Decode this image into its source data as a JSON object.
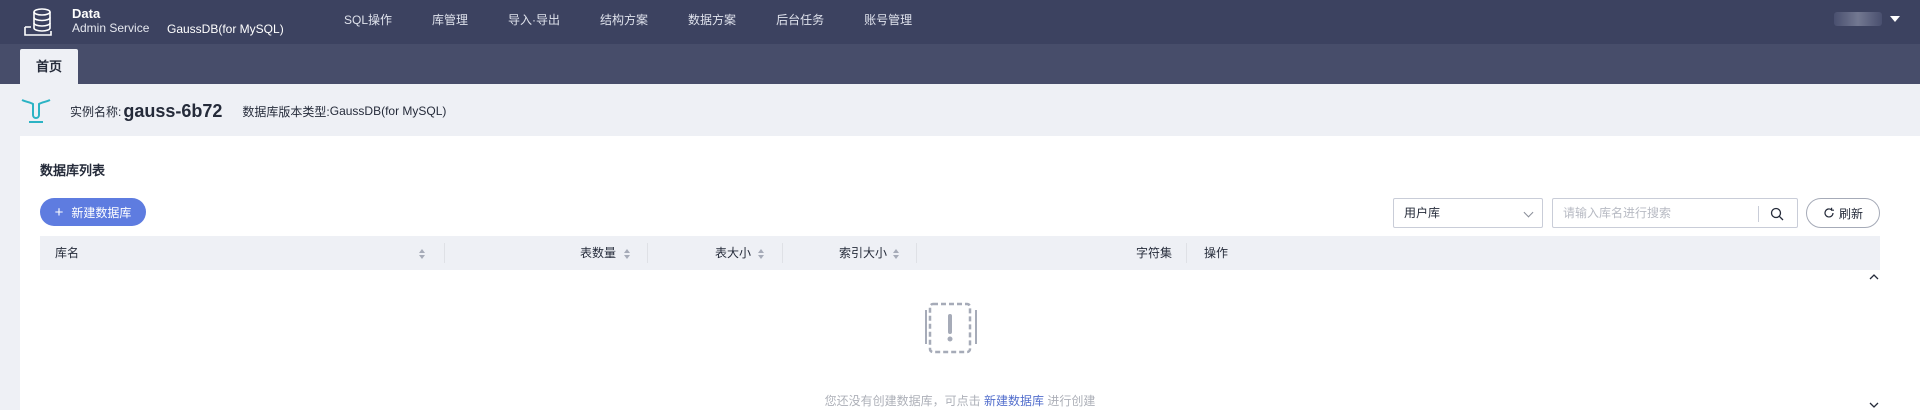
{
  "brand": {
    "line1": "Data",
    "line2": "Admin Service",
    "product": "GaussDB(for MySQL)"
  },
  "nav": [
    "SQL操作",
    "库管理",
    "导入·导出",
    "结构方案",
    "数据方案",
    "后台任务",
    "账号管理"
  ],
  "tabs": {
    "home": "首页"
  },
  "instance": {
    "name_label": "实例名称:",
    "name": "gauss-6b72",
    "type_label": "数据库版本类型:",
    "type": "GaussDB(for MySQL)"
  },
  "card": {
    "title": "数据库列表",
    "new_db_button": "新建数据库",
    "select_value": "用户库",
    "search_placeholder": "请输入库名进行搜索",
    "refresh_button": "刷新"
  },
  "table": {
    "columns": [
      "库名",
      "表数量",
      "表大小",
      "索引大小",
      "字符集",
      "操作"
    ]
  },
  "empty": {
    "prefix": "您还没有创建数据库，可点击",
    "link": "新建数据库",
    "suffix": "进行创建"
  },
  "colors": {
    "topbar": "#3c4260",
    "accent": "#5e7ce0",
    "link": "#526ecc"
  }
}
